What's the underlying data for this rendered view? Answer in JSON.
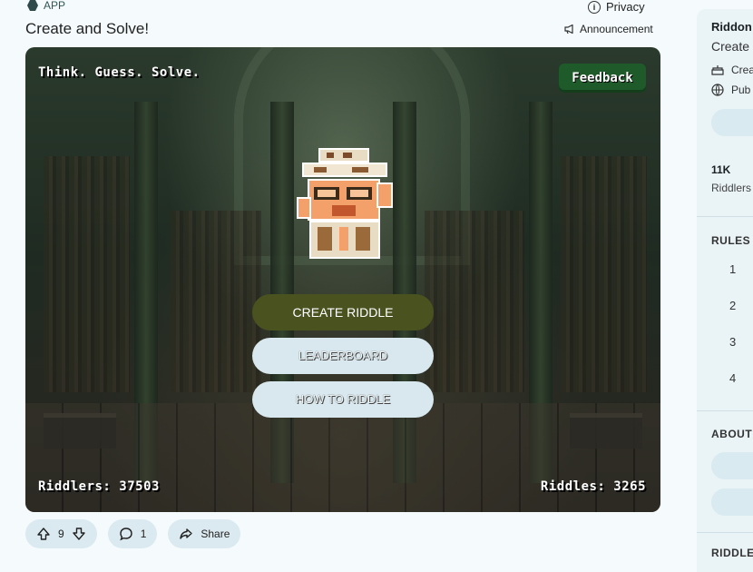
{
  "header": {
    "app_tag": "APP",
    "post_title": "Create and Solve!",
    "privacy_label": "Privacy",
    "announcement_label": "Announcement"
  },
  "game": {
    "tagline": "Think. Guess. Solve.",
    "feedback_label": "Feedback",
    "create_label": "CREATE RIDDLE",
    "leaderboard_label": "LEADERBOARD",
    "howto_label": "HOW TO RIDDLE",
    "riddlers_stat": "Riddlers: 37503",
    "riddles_stat": "Riddles: 3265"
  },
  "actions": {
    "vote_count": "9",
    "comment_count": "1",
    "share_label": "Share"
  },
  "sidebar": {
    "title": "Riddon",
    "subtitle": "Create",
    "row1": "Crea",
    "row2": "Pub",
    "stat_value": "11K",
    "stat_label": "Riddlers",
    "rules_heading": "RULES",
    "rules": [
      "1",
      "2",
      "3",
      "4"
    ],
    "about_heading": "ABOUT",
    "bottom_heading": "RIDDLE"
  },
  "colors": {
    "create_button": "#4a5320",
    "feedback_button": "#1f5a2a",
    "secondary_button": "#d8e8ee",
    "page_bg": "#f5fbfd"
  }
}
